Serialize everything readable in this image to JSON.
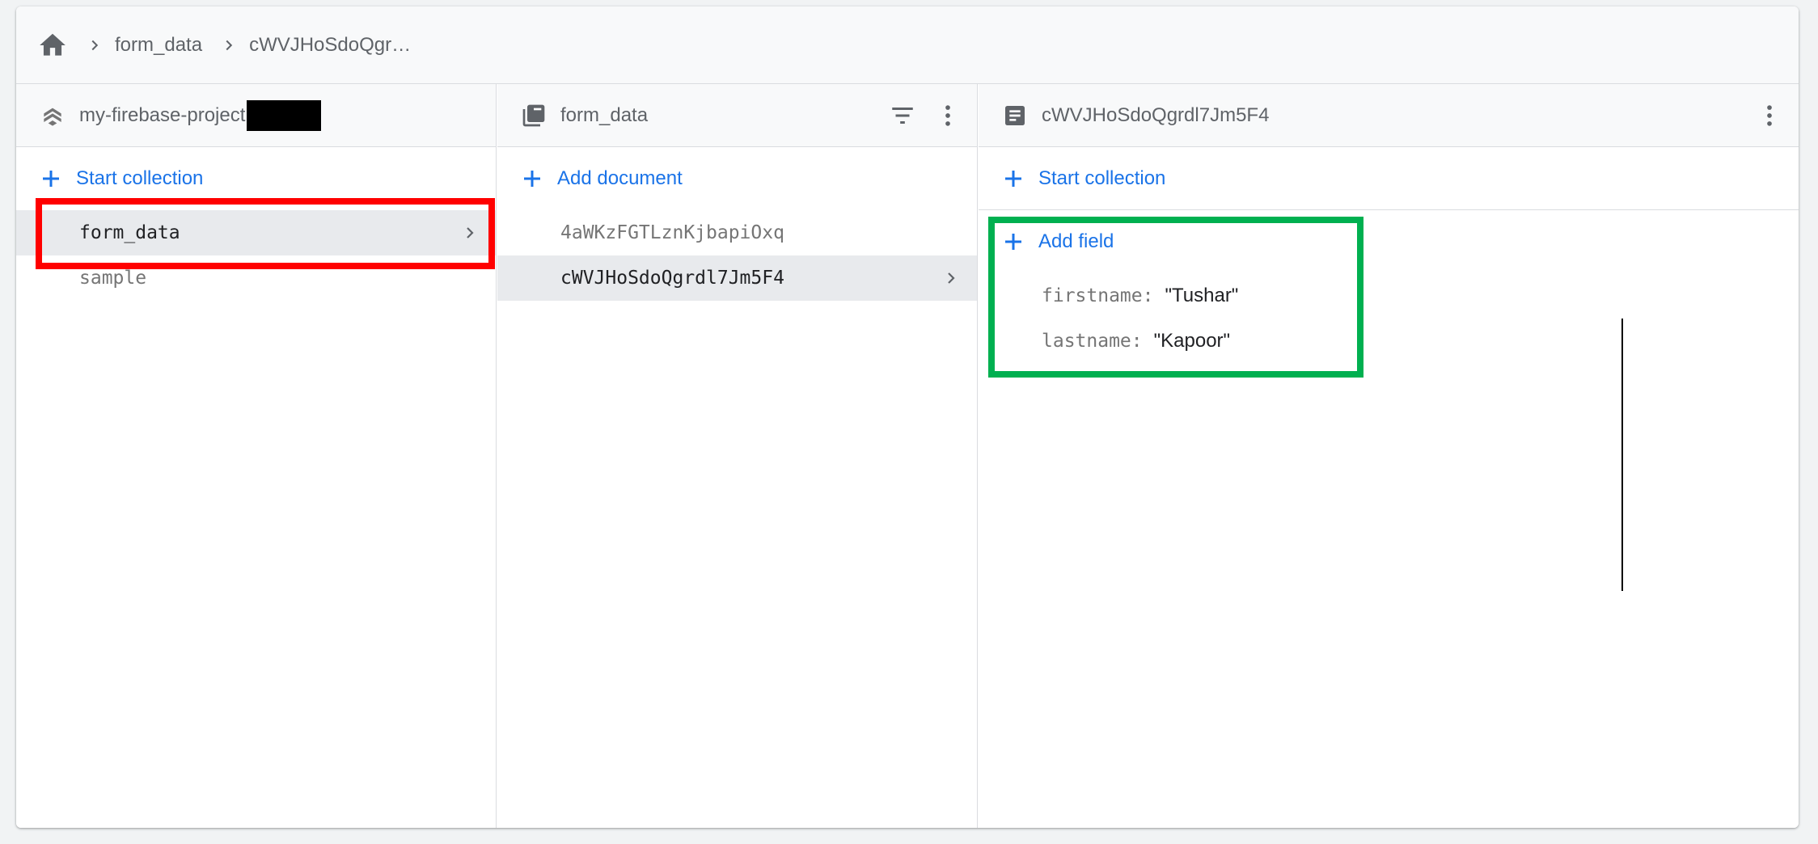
{
  "breadcrumb": {
    "home_icon": "home-icon",
    "items": [
      "form_data",
      "cWVJHoSdoQgr…"
    ]
  },
  "panels": {
    "root": {
      "icon": "firestore-icon",
      "title": "my-firebase-project",
      "action_label": "Start collection",
      "items": [
        {
          "label": "form_data",
          "selected": true
        },
        {
          "label": "sample",
          "selected": false
        }
      ]
    },
    "collection": {
      "icon": "collection-icon",
      "title": "form_data",
      "filter_icon": "filter-icon",
      "menu_icon": "more-vert-icon",
      "action_label": "Add document",
      "items": [
        {
          "label": "4aWKzFGTLznKjbapiOxq",
          "selected": false
        },
        {
          "label": "cWVJHoSdoQgrdl7Jm5F4",
          "selected": true
        }
      ]
    },
    "document": {
      "icon": "document-icon",
      "title": "cWVJHoSdoQgrdl7Jm5F4",
      "menu_icon": "more-vert-icon",
      "action_label": "Start collection",
      "add_field_label": "Add field",
      "fields": [
        {
          "key": "firstname",
          "value": "\"Tushar\""
        },
        {
          "key": "lastname",
          "value": "\"Kapoor\""
        }
      ]
    }
  },
  "colors": {
    "accent": "#1a73e8",
    "highlight_red": "#ff0000",
    "highlight_green": "#00b050"
  }
}
